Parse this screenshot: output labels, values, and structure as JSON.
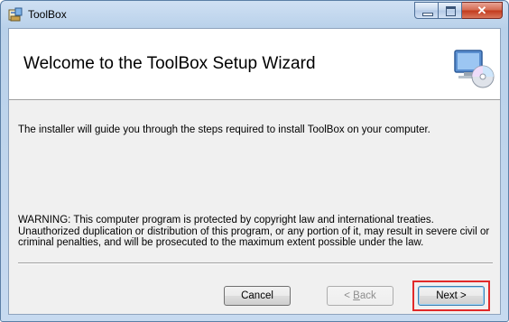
{
  "window": {
    "title": "ToolBox",
    "controls": {
      "minimize": "minimize",
      "maximize": "maximize",
      "close": "x"
    }
  },
  "banner": {
    "title": "Welcome to the ToolBox Setup Wizard",
    "icon": "computer-cd-icon"
  },
  "body": {
    "intro": "The installer will guide you through the steps required to install ToolBox on your computer.",
    "warning": "WARNING: This computer program is protected by copyright law and international treaties. Unauthorized duplication or distribution of this program, or any portion of it, may result in severe civil or criminal penalties, and will be prosecuted to the maximum extent possible under the law."
  },
  "buttons": {
    "cancel": "Cancel",
    "back_mnemonic": "B",
    "back_rest": "ack",
    "back_prefix": "< ",
    "next": "Next >"
  },
  "colors": {
    "highlight": "#e12a2a",
    "title_bar": "#c7daf0",
    "close_button": "#c2391b"
  }
}
